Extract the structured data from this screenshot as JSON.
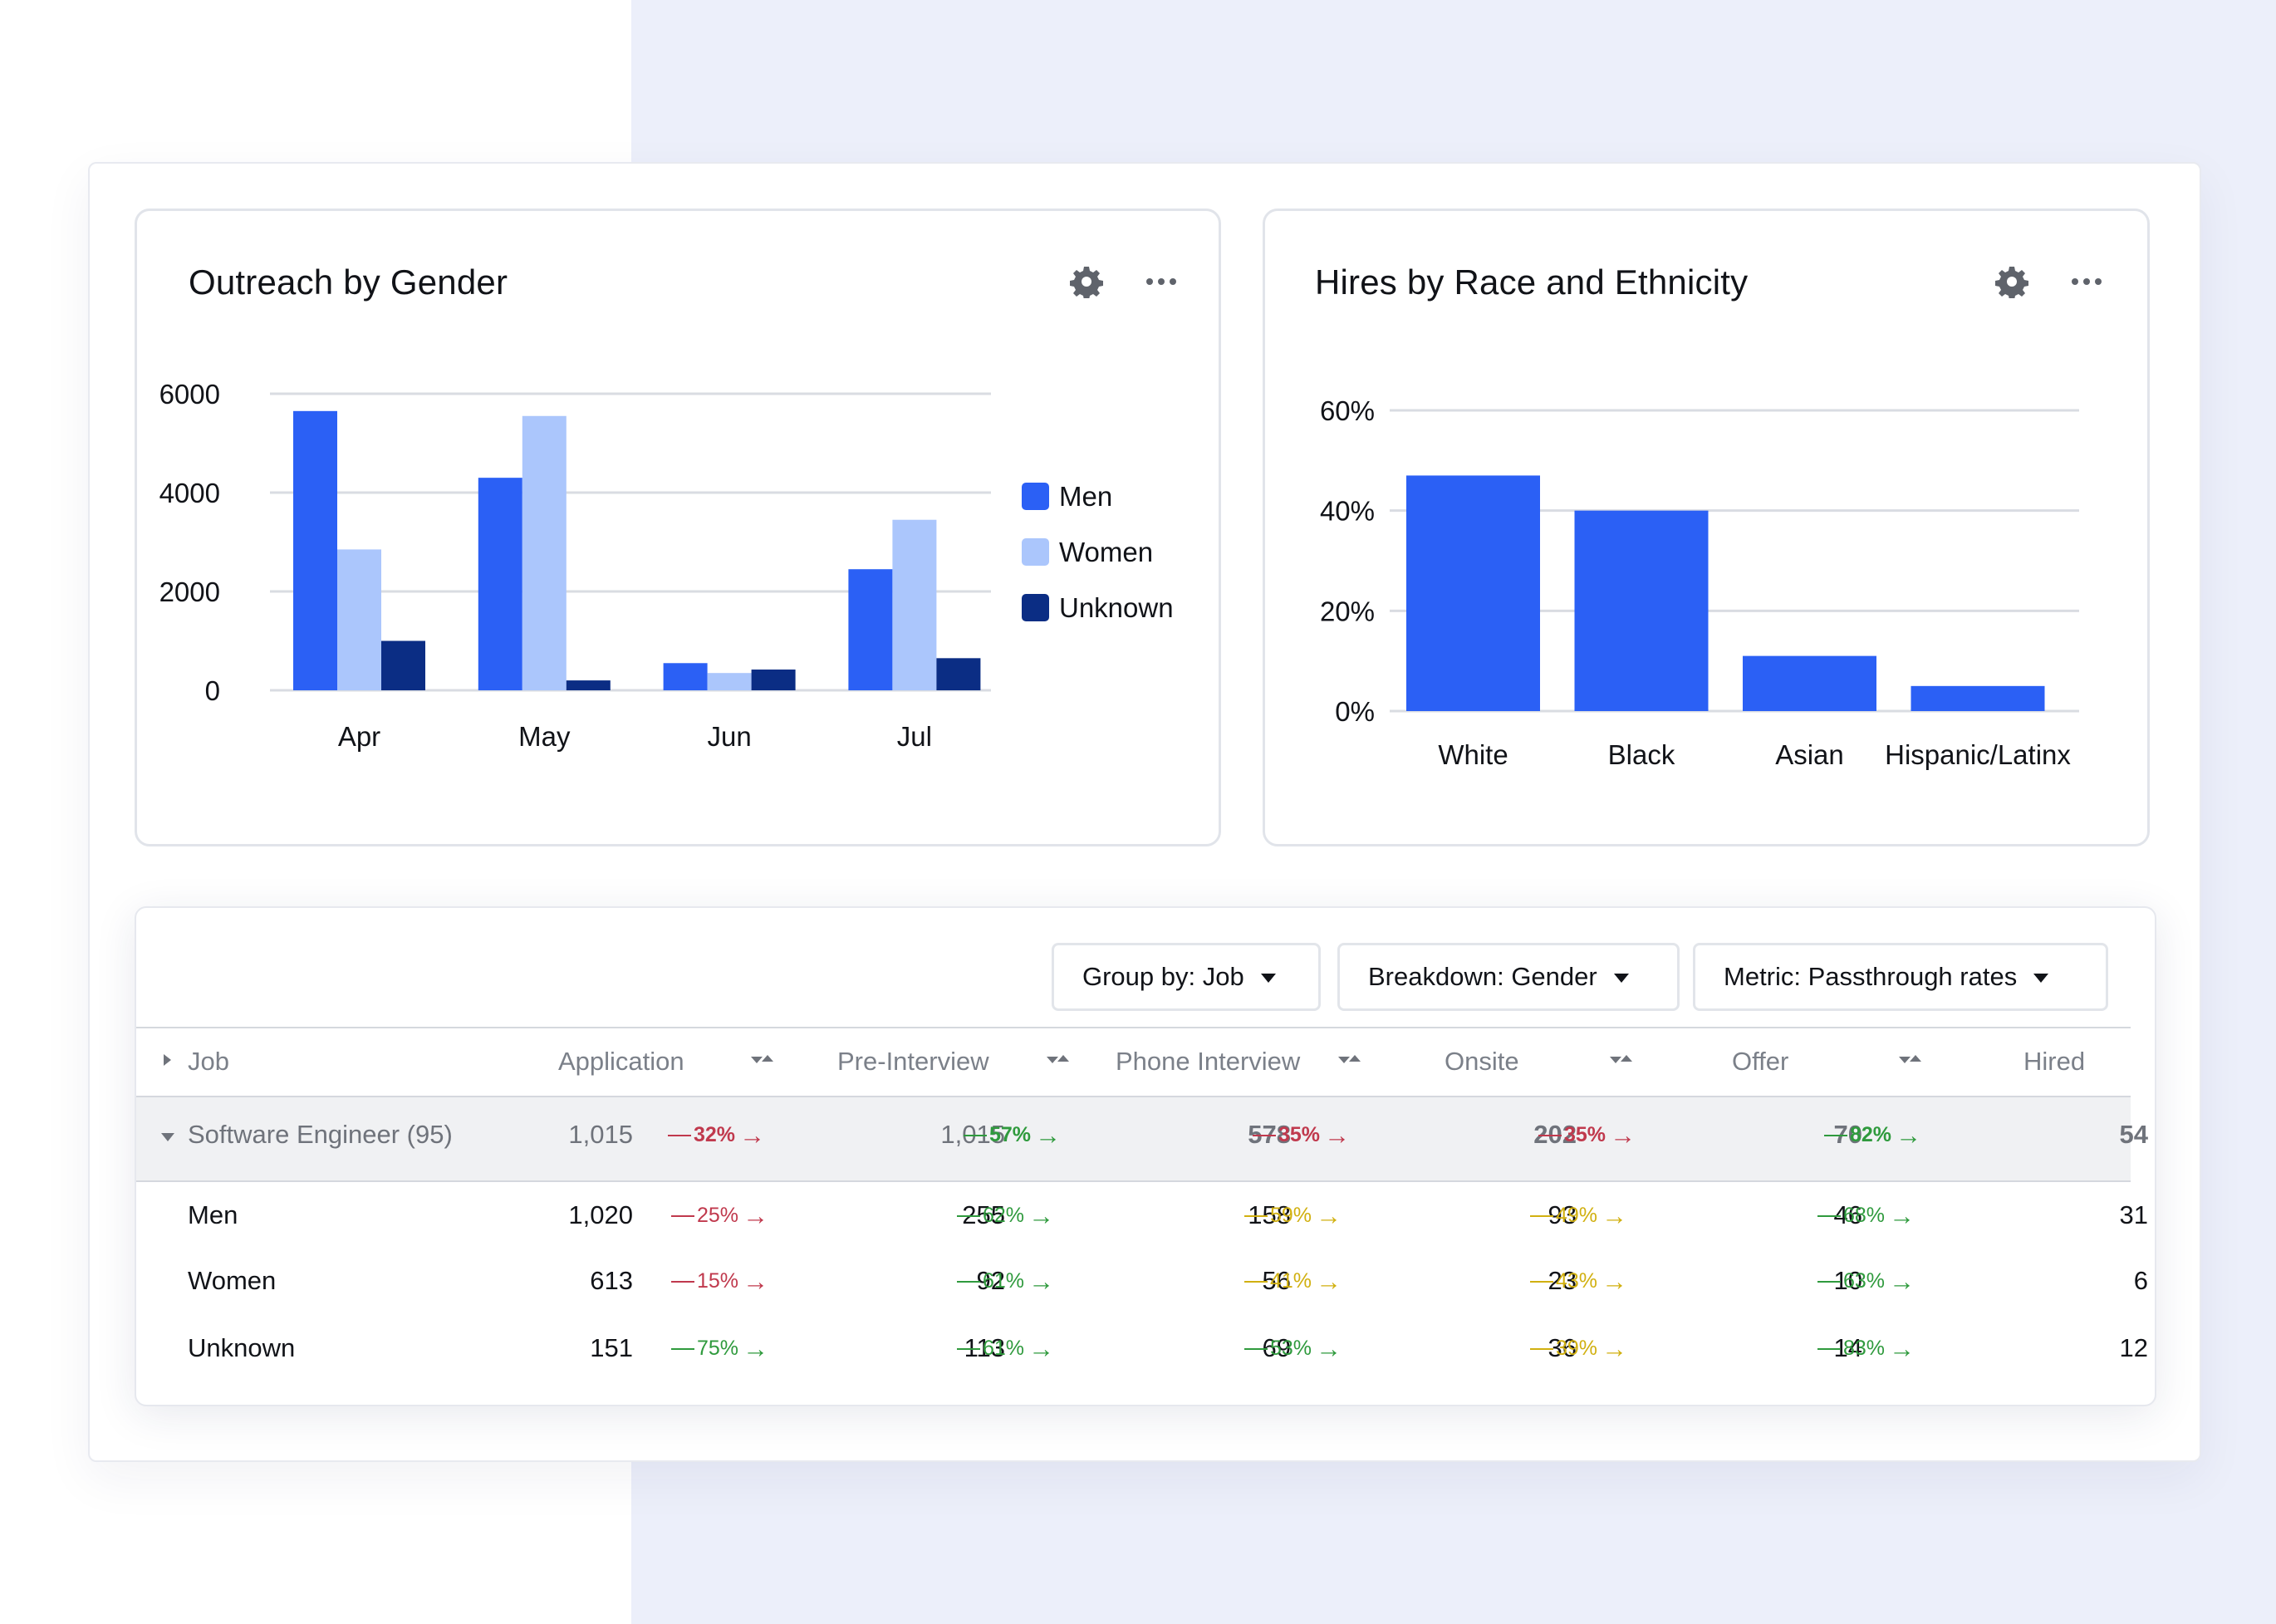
{
  "colors": {
    "men": "#2b60f5",
    "women": "#abc6fc",
    "unknown": "#0b2d84",
    "hires_bar": "#2b60f5",
    "grid": "#d9dce2",
    "red": "#c0394d",
    "green": "#2f9a3d",
    "yellow": "#d1b010"
  },
  "icons": {
    "settings": "gear-icon",
    "more": "more-horizontal-icon"
  },
  "outreach_card": {
    "title": "Outreach by Gender"
  },
  "hires_card": {
    "title": "Hires by Race and Ethnicity"
  },
  "chart_data": [
    {
      "type": "bar",
      "title": "Outreach by Gender",
      "categories": [
        "Apr",
        "May",
        "Jun",
        "Jul"
      ],
      "series": [
        {
          "name": "Men",
          "values": [
            5650,
            4300,
            550,
            2450
          ]
        },
        {
          "name": "Women",
          "values": [
            2850,
            5550,
            350,
            3450
          ]
        },
        {
          "name": "Unknown",
          "values": [
            1000,
            200,
            420,
            650
          ]
        }
      ],
      "ylim": [
        0,
        6000
      ],
      "yticks": [
        0,
        2000,
        4000,
        6000
      ],
      "ytick_labels": [
        "0",
        "2000",
        "4000",
        "6000"
      ],
      "grid": true,
      "legend": "right"
    },
    {
      "type": "bar",
      "title": "Hires by Race and Ethnicity",
      "categories": [
        "White",
        "Black",
        "Asian",
        "Hispanic/Latinx"
      ],
      "values": [
        47,
        40,
        11,
        5
      ],
      "ylim": [
        0,
        60
      ],
      "yticks": [
        0,
        20,
        40,
        60
      ],
      "ytick_labels": [
        "0%",
        "20%",
        "40%",
        "60%"
      ],
      "grid": true,
      "legend": "none"
    }
  ],
  "filters": {
    "group_by": "Group by: Job",
    "breakdown": "Breakdown: Gender",
    "metric": "Metric: Passthrough rates"
  },
  "table": {
    "job_header": "Job",
    "stages": [
      "Application",
      "Pre-Interview",
      "Phone Interview",
      "Onsite",
      "Offer",
      "Hired"
    ],
    "group": {
      "label": "Software Engineer (95)",
      "values": [
        "1,015",
        "1,015",
        "578",
        "202",
        "70",
        "54"
      ],
      "rates": [
        {
          "text": "32%",
          "color": "red"
        },
        {
          "text": "57%",
          "color": "green"
        },
        {
          "text": "35%",
          "color": "red"
        },
        {
          "text": "35%",
          "color": "red"
        },
        {
          "text": "82%",
          "color": "green"
        }
      ]
    },
    "rows": [
      {
        "label": "Men",
        "values": [
          "1,020",
          "255",
          "158",
          "93",
          "46",
          "31"
        ],
        "rates": [
          {
            "text": "25%",
            "color": "red"
          },
          {
            "text": "62%",
            "color": "green"
          },
          {
            "text": "59%",
            "color": "yellow"
          },
          {
            "text": "49%",
            "color": "yellow"
          },
          {
            "text": "68%",
            "color": "green"
          }
        ]
      },
      {
        "label": "Women",
        "values": [
          "613",
          "92",
          "56",
          "23",
          "10",
          "6"
        ],
        "rates": [
          {
            "text": "15%",
            "color": "red"
          },
          {
            "text": "61%",
            "color": "green"
          },
          {
            "text": "41%",
            "color": "yellow"
          },
          {
            "text": "43%",
            "color": "yellow"
          },
          {
            "text": "63%",
            "color": "green"
          }
        ]
      },
      {
        "label": "Unknown",
        "values": [
          "151",
          "113",
          "69",
          "36",
          "14",
          "12"
        ],
        "rates": [
          {
            "text": "75%",
            "color": "green"
          },
          {
            "text": "61%",
            "color": "green"
          },
          {
            "text": "53%",
            "color": "green"
          },
          {
            "text": "39%",
            "color": "yellow"
          },
          {
            "text": "83%",
            "color": "green"
          }
        ]
      }
    ]
  }
}
